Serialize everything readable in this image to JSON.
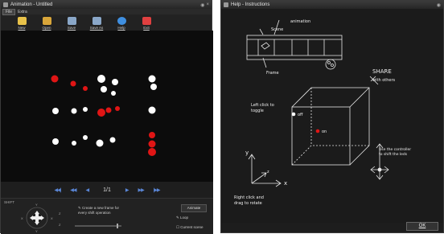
{
  "animation_window": {
    "title": "Animation - Untitled",
    "menu": [
      "File",
      "Extra"
    ],
    "toolbar": [
      {
        "label": "New",
        "icon": "new-file-icon",
        "color": "#e8c24a"
      },
      {
        "label": "Open",
        "icon": "open-folder-icon",
        "color": "#d9a63a"
      },
      {
        "label": "Save",
        "icon": "save-icon",
        "color": "#8aa7c8"
      },
      {
        "label": "Save As",
        "icon": "save-as-icon",
        "color": "#8aa7c8"
      },
      {
        "label": "Help",
        "icon": "help-icon",
        "color": "#3f8fe0"
      },
      {
        "label": "Exit",
        "icon": "power-icon",
        "color": "#e04040"
      }
    ],
    "frame_counter": "1/1",
    "shift_label": "SHIFT",
    "dpad_labels": {
      "top": "Y",
      "bottom": "Y",
      "left": "X",
      "right": "X",
      "z_top": "Z",
      "z_bottom": "Z"
    },
    "hint_text": "Create a new frame for every shift operation",
    "animate_label": "Animate",
    "loop_label": "Loop",
    "current_scene_label": "Current scene",
    "led_on_color": "#e01515",
    "led_off_color": "#ffffff"
  },
  "help_window": {
    "title": "Help - Instructions",
    "ok_label": "OK",
    "notes": {
      "scene": "Scene",
      "animation": "animation",
      "frame": "Frame",
      "share": "SHARE",
      "share_sub": "with others",
      "left_click": "Left click to toggle",
      "off": "off",
      "on": "on",
      "controller": "Use the controller to shift the leds",
      "right_click": "Right click and drag to rotate",
      "axis_y": "y",
      "axis_x": "x",
      "axis_z": "z"
    }
  }
}
